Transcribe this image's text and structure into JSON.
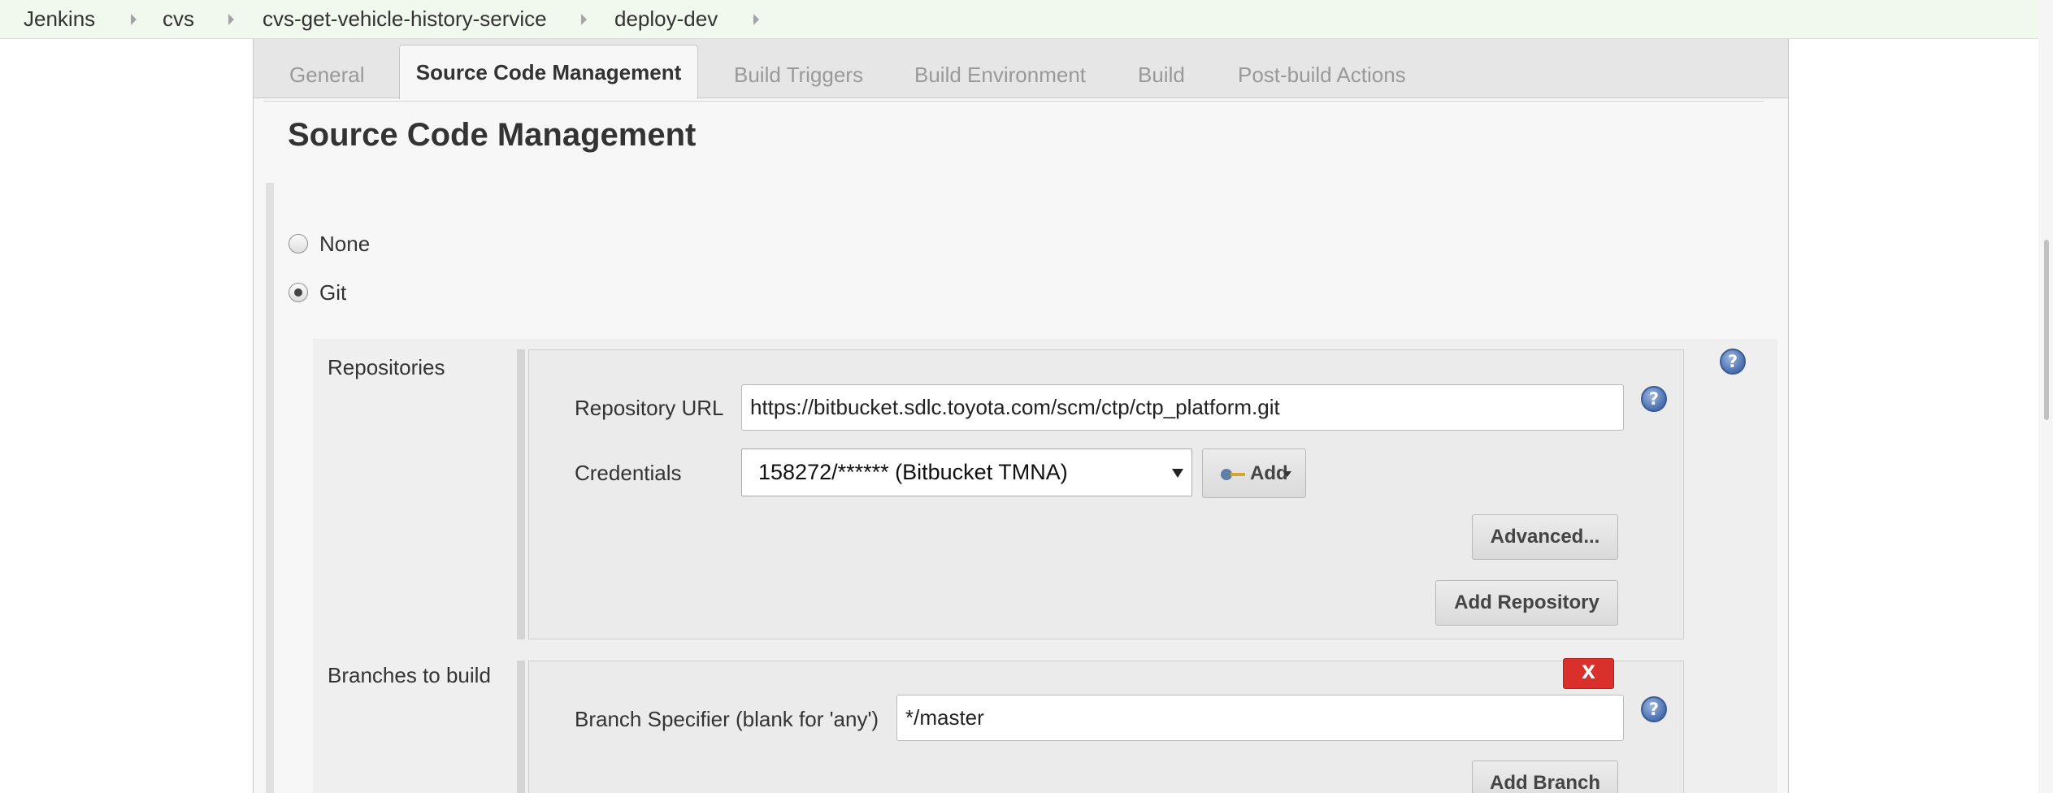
{
  "breadcrumb": {
    "items": [
      "Jenkins",
      "cvs",
      "cvs-get-vehicle-history-service",
      "deploy-dev"
    ]
  },
  "tabs": [
    {
      "label": "General"
    },
    {
      "label": "Source Code Management",
      "active": true
    },
    {
      "label": "Build Triggers"
    },
    {
      "label": "Build Environment"
    },
    {
      "label": "Build"
    },
    {
      "label": "Post-build Actions"
    }
  ],
  "section": {
    "title": "Source Code Management"
  },
  "scm_options": [
    {
      "label": "None",
      "selected": false
    },
    {
      "label": "Git",
      "selected": true
    }
  ],
  "repositories": {
    "label": "Repositories",
    "url_label": "Repository URL",
    "url_value": "https://bitbucket.sdlc.toyota.com/scm/ctp/ctp_platform.git",
    "credentials_label": "Credentials",
    "credentials_value": "158272/****** (Bitbucket TMNA)",
    "add_label": "Add",
    "advanced_label": "Advanced...",
    "add_repository_label": "Add Repository"
  },
  "branches": {
    "label": "Branches to build",
    "delete_label": "X",
    "specifier_label": "Branch Specifier (blank for 'any')",
    "specifier_value": "*/master",
    "add_branch_label": "Add Branch"
  },
  "help_icon_glyph": "?",
  "colors": {
    "breadcrumb_bg": "#f1f8ee",
    "delete_red": "#d9302b",
    "help_blue": "#4a6fae"
  }
}
